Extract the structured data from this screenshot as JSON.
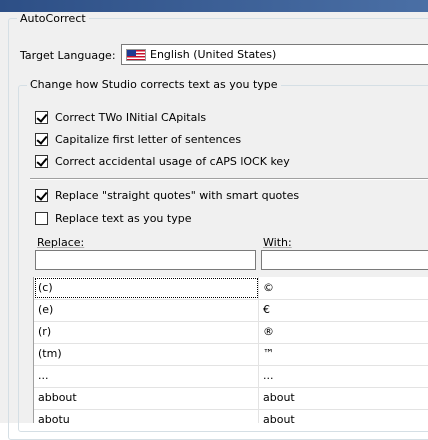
{
  "autocorrect_group": {
    "title": "AutoCorrect"
  },
  "target_language": {
    "label": "Target Language:",
    "value": "English (United States)",
    "flag_icon": "us-flag-icon"
  },
  "change_group": {
    "title": "Change how Studio corrects text as you type"
  },
  "options": [
    {
      "label": "Correct TWo INitial CApitals",
      "checked": true
    },
    {
      "label": "Capitalize first letter of sentences",
      "checked": true
    },
    {
      "label": "Correct accidental usage of cAPS lOCK key",
      "checked": true
    }
  ],
  "smart_quotes": {
    "label": "Replace \"straight quotes\" with smart quotes",
    "checked": true
  },
  "replace_as_you_type": {
    "label": "Replace text as you type",
    "checked": false
  },
  "replace_table": {
    "replace_label": "Replace:",
    "with_label": "With:",
    "replace_value": "",
    "with_value": "",
    "rows": [
      {
        "replace": "(c)",
        "with": "©"
      },
      {
        "replace": "(e)",
        "with": "€"
      },
      {
        "replace": "(r)",
        "with": "®"
      },
      {
        "replace": "(tm)",
        "with": "™"
      },
      {
        "replace": "...",
        "with": "..."
      },
      {
        "replace": "abbout",
        "with": "about"
      },
      {
        "replace": "abotu",
        "with": "about"
      }
    ]
  },
  "colors": {
    "titlebar": "#2d4f86",
    "dialog_bg": "#f0f0f0",
    "groupbox_border": "#d5dfe5"
  }
}
